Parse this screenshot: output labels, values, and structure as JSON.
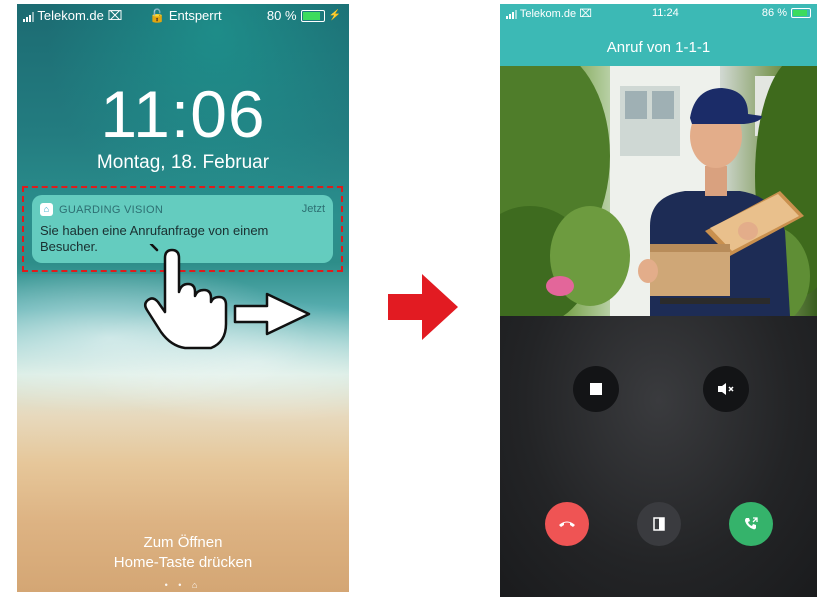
{
  "left_phone": {
    "status_bar": {
      "carrier": "Telekom.de",
      "lock_status": "Entsperrt",
      "battery": "80 %"
    },
    "clock": "11:06",
    "date": "Montag, 18. Februar",
    "notification": {
      "app": "GUARDING VISION",
      "time": "Jetzt",
      "message": "Sie haben eine Anrufanfrage von einem Besucher."
    },
    "footer": {
      "line1": "Zum Öffnen",
      "line2": "Home-Taste drücken",
      "page_dots": "• • ⌂"
    }
  },
  "right_phone": {
    "status_bar": {
      "carrier": "Telekom.de",
      "time": "11:24",
      "battery": "86 %"
    },
    "title": "Anruf von 1-1-1",
    "controls": [
      "stop",
      "mute",
      "hangup",
      "unlock-door",
      "answer"
    ]
  },
  "colors": {
    "accent": "#3cb9b5",
    "arrow": "#e21b22",
    "hangup": "#ef5454",
    "answer": "#35b36b",
    "highlight": "#e01b1b"
  }
}
